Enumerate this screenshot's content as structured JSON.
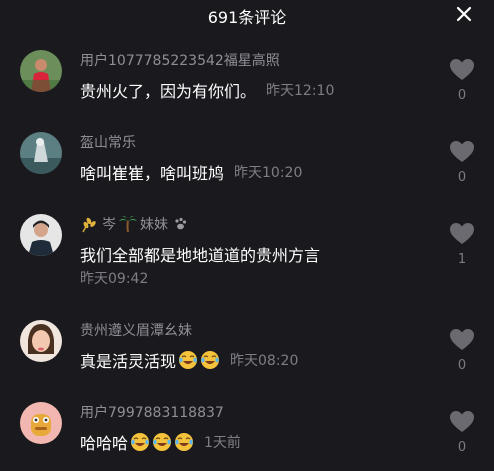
{
  "header": {
    "title": "691条评论"
  },
  "comments": [
    {
      "user": "用户1077785223542福星高照",
      "text": "贵州火了，因为有你们。",
      "time": "昨天12:10",
      "likes": "0"
    },
    {
      "user": "盔山常乐",
      "text": "啥叫崔崔，啥叫班鸠",
      "time": "昨天10:20",
      "likes": "0"
    },
    {
      "user": "岑",
      "user_suffix": "妹妹",
      "text": "我们全部都是地地道道的贵州方言",
      "time": "昨天09:42",
      "likes": "1"
    },
    {
      "user": "贵州遵义眉潭幺妹",
      "text": "真是活灵活现",
      "time": "昨天08:20",
      "likes": "0"
    },
    {
      "user": "用户7997883118837",
      "text": "哈哈哈",
      "time": "1天前",
      "likes": "0"
    }
  ],
  "icons": {
    "close": "close-icon",
    "like": "heart-icon",
    "laugh": "laughing-crying-emoji"
  },
  "colors": {
    "background": "#1a1a1e",
    "username": "#8e8e96",
    "meta": "#7d7d86"
  }
}
